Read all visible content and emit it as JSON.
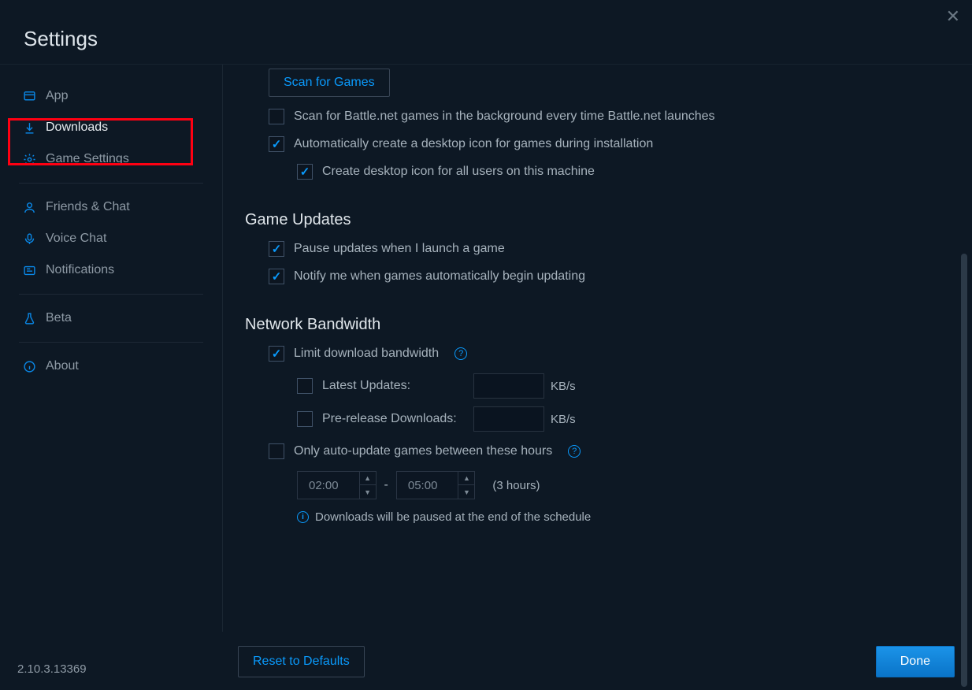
{
  "title": "Settings",
  "sidebar": {
    "app": "App",
    "downloads": "Downloads",
    "game_settings": "Game Settings",
    "friends_chat": "Friends & Chat",
    "voice_chat": "Voice Chat",
    "notifications": "Notifications",
    "beta": "Beta",
    "about": "About"
  },
  "scan_button": "Scan for Games",
  "checks": {
    "scan_bg": "Scan for Battle.net games in the background every time Battle.net launches",
    "auto_icon": "Automatically create a desktop icon for games during installation",
    "icon_all_users": "Create desktop icon for all users on this machine"
  },
  "section_updates": "Game Updates",
  "updates": {
    "pause": "Pause updates when I launch a game",
    "notify": "Notify me when games automatically begin updating"
  },
  "section_bandwidth": "Network Bandwidth",
  "bandwidth": {
    "limit": "Limit download bandwidth",
    "latest": "Latest Updates:",
    "prerelease": "Pre-release Downloads:",
    "unit": "KB/s",
    "only_between": "Only auto-update games between these hours",
    "time_start": "02:00",
    "time_end": "05:00",
    "duration": "(3 hours)",
    "info": "Downloads will be paused at the end of the schedule"
  },
  "footer": {
    "reset": "Reset to Defaults",
    "done": "Done"
  },
  "version": "2.10.3.13369"
}
